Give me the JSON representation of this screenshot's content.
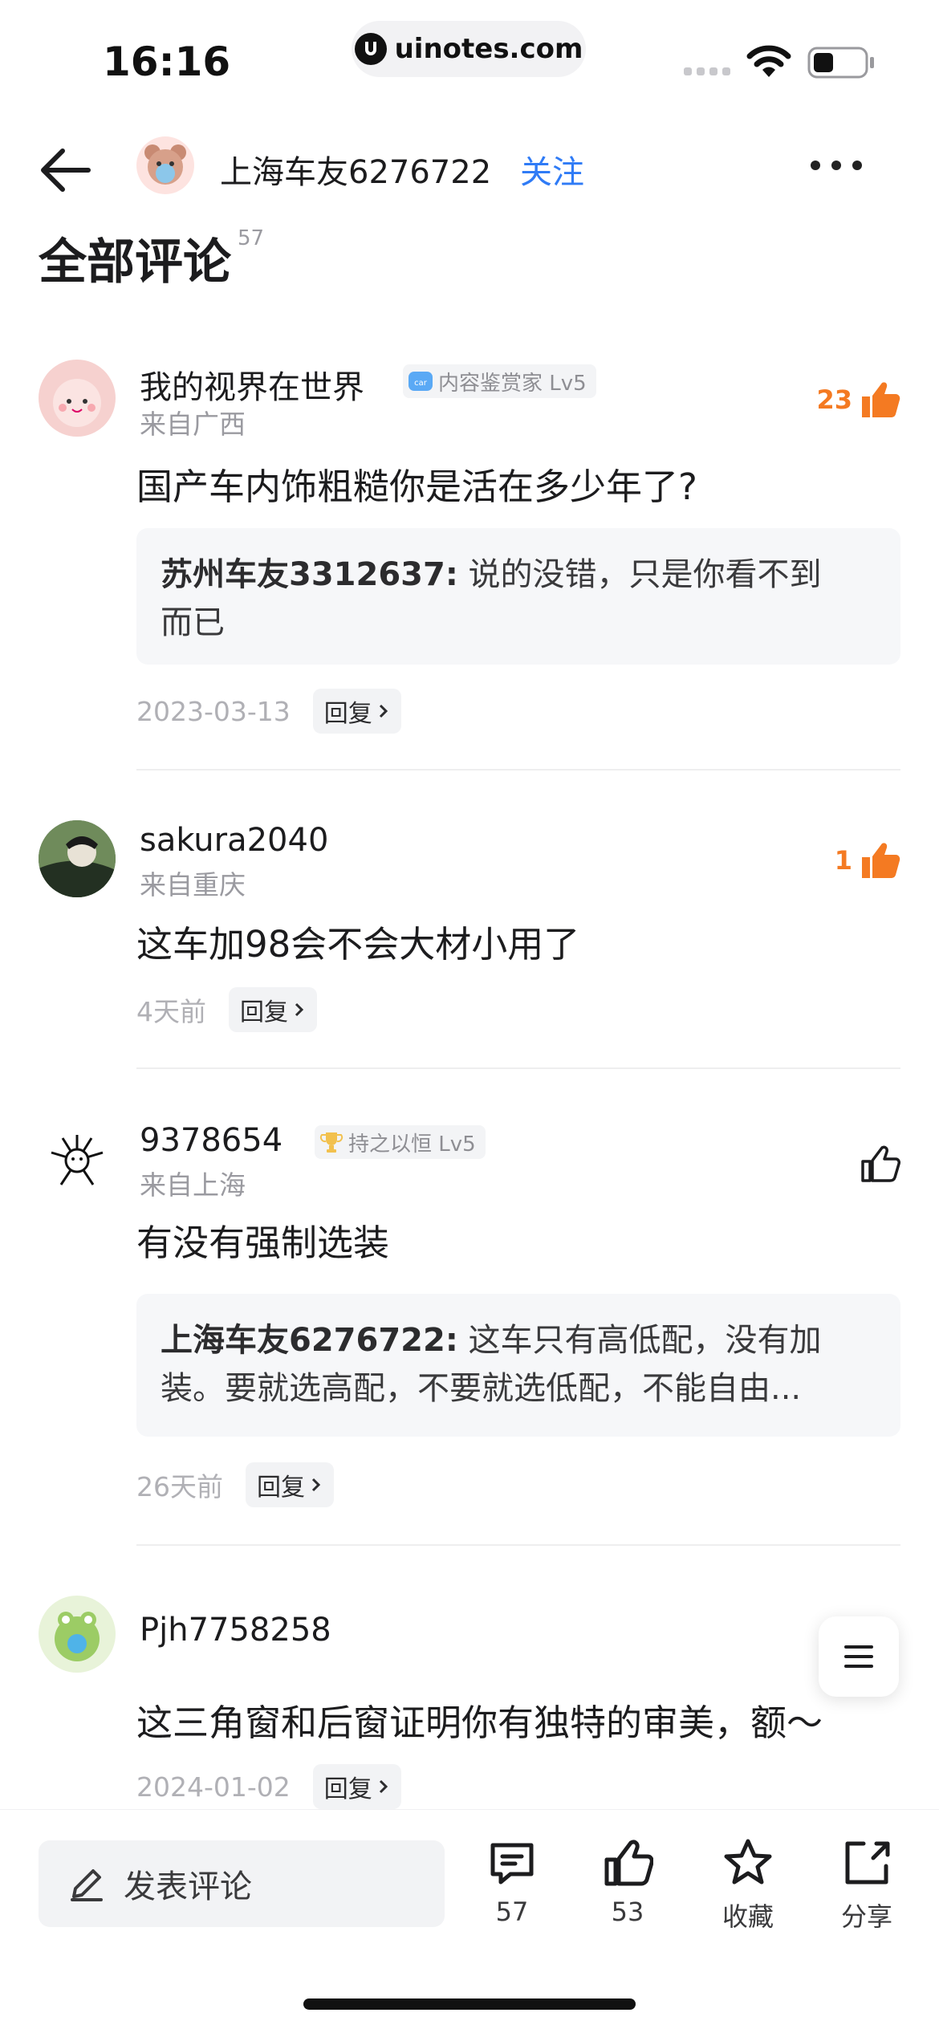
{
  "status_bar": {
    "time": "16:16",
    "url": "uinotes.com"
  },
  "header": {
    "author_name": "上海车友6276722",
    "follow_label": "关注"
  },
  "section": {
    "title": "全部评论",
    "count": "57"
  },
  "comments": [
    {
      "name": "我的视界在世界",
      "badge": "内容鉴赏家 Lv5",
      "location": "来自广西",
      "text": "国产车内饰粗糙你是活在多少年了?",
      "reply_author": "苏州车友3312637:",
      "reply_line1": " 说的没错，只是你看不到",
      "reply_line2": "而已",
      "date": "2023-03-13",
      "reply_label": "回复",
      "likes": "23"
    },
    {
      "name": "sakura2040",
      "location": "来自重庆",
      "text": "这车加98会不会大材小用了",
      "date": "4天前",
      "reply_label": "回复",
      "likes": "1"
    },
    {
      "name": "9378654",
      "badge": "持之以恒 Lv5",
      "location": "来自上海",
      "text": "有没有强制选装",
      "reply_author": "上海车友6276722:",
      "reply_line1": " 这车只有高低配，没有加",
      "reply_line2": "装。要就选高配，不要就选低配，不能自由...",
      "date": "26天前",
      "reply_label": "回复"
    },
    {
      "name": "Pjh7758258",
      "text": "这三角窗和后窗证明你有独特的审美，额～",
      "date": "2024-01-02",
      "reply_label": "回复"
    }
  ],
  "bottom_bar": {
    "input_placeholder": "发表评论",
    "comment_count": "57",
    "like_count": "53",
    "collect_label": "收藏",
    "share_label": "分享"
  },
  "colors": {
    "accent_blue": "#2f7bf6",
    "like_orange": "#f47a22"
  }
}
